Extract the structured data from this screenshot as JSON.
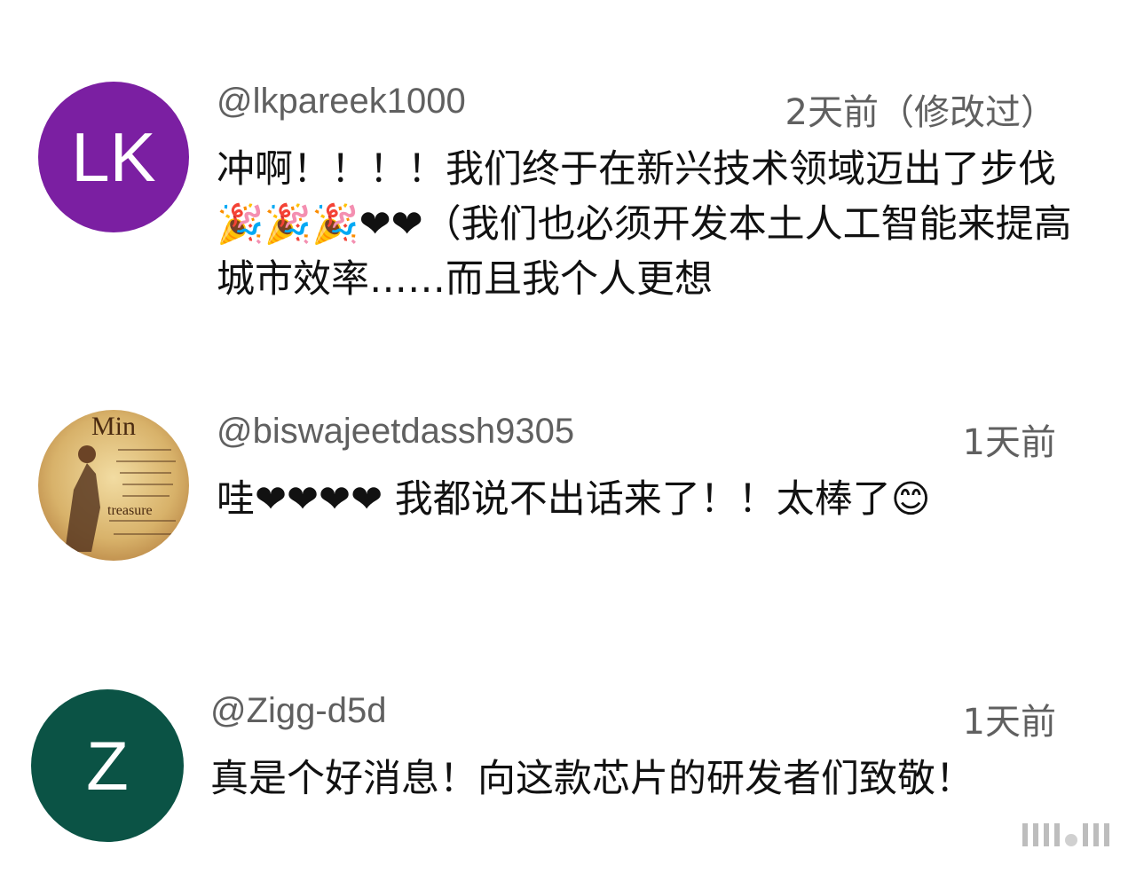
{
  "comments": [
    {
      "avatar_initials": "LK",
      "avatar_color": "#7b1fa2",
      "handle": "@lkpareek1000",
      "time": "2天前（修改过）",
      "text": "冲啊！！！！我们终于在新兴技术领域迈出了步伐🎉🎉🎉❤❤（我们也必须开发本土人工智能来提高城市效率……而且我个人更想"
    },
    {
      "avatar_image": "illustrated-portrait",
      "avatar_color": "#e5c27a",
      "handle": "@biswajeetdassh9305",
      "time": "1天前",
      "text": "哇❤❤❤❤ 我都说不出话来了！！太棒了😊"
    },
    {
      "avatar_initials": "Z",
      "avatar_color": "#0b5345",
      "handle": "@Zigg-d5d",
      "time": "1天前",
      "text": "真是个好消息！向这款芯片的研发者们致敬！"
    }
  ]
}
